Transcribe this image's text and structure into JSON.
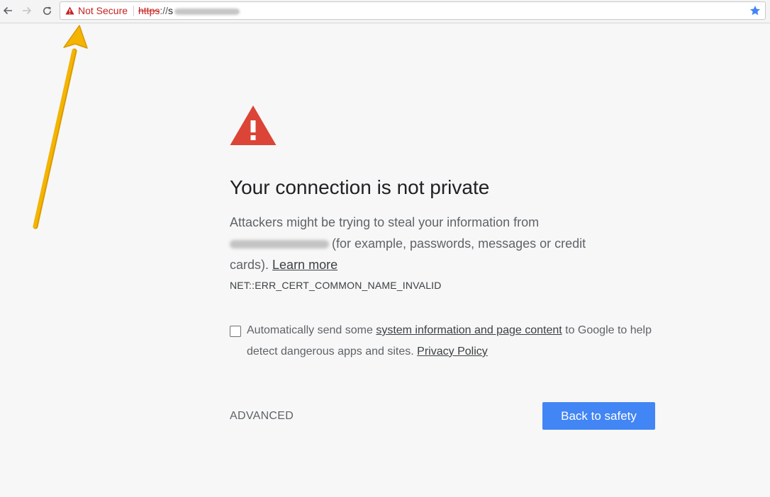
{
  "toolbar": {
    "security_chip_label": "Not Secure",
    "url_scheme": "https",
    "url_separator": "://",
    "url_host_visible": "s"
  },
  "interstitial": {
    "heading": "Your connection is not private",
    "explanation_part1": "Attackers might be trying to steal your information from",
    "explanation_part2": "(for example, passwords, messages or credit cards).",
    "learn_more": "Learn more",
    "error_code": "NET::ERR_CERT_COMMON_NAME_INVALID",
    "optin_part1": "Automatically send some",
    "optin_link": "system information and page content",
    "optin_part2": "to Google to help detect dangerous apps and sites.",
    "privacy_policy": "Privacy Policy",
    "advanced_label": "ADVANCED",
    "back_to_safety_label": "Back to safety"
  },
  "colors": {
    "not_secure_red": "#c5221f",
    "warning_triangle": "#db4437",
    "primary_button": "#4285f4",
    "annotation_arrow": "#f4b400",
    "bookmark_star": "#4285f4"
  },
  "icons": {
    "back": "arrow-left-icon",
    "forward": "arrow-right-icon",
    "reload": "reload-icon",
    "security": "warning-triangle-icon",
    "bookmark": "star-icon",
    "page_warning": "warning-triangle-icon"
  }
}
